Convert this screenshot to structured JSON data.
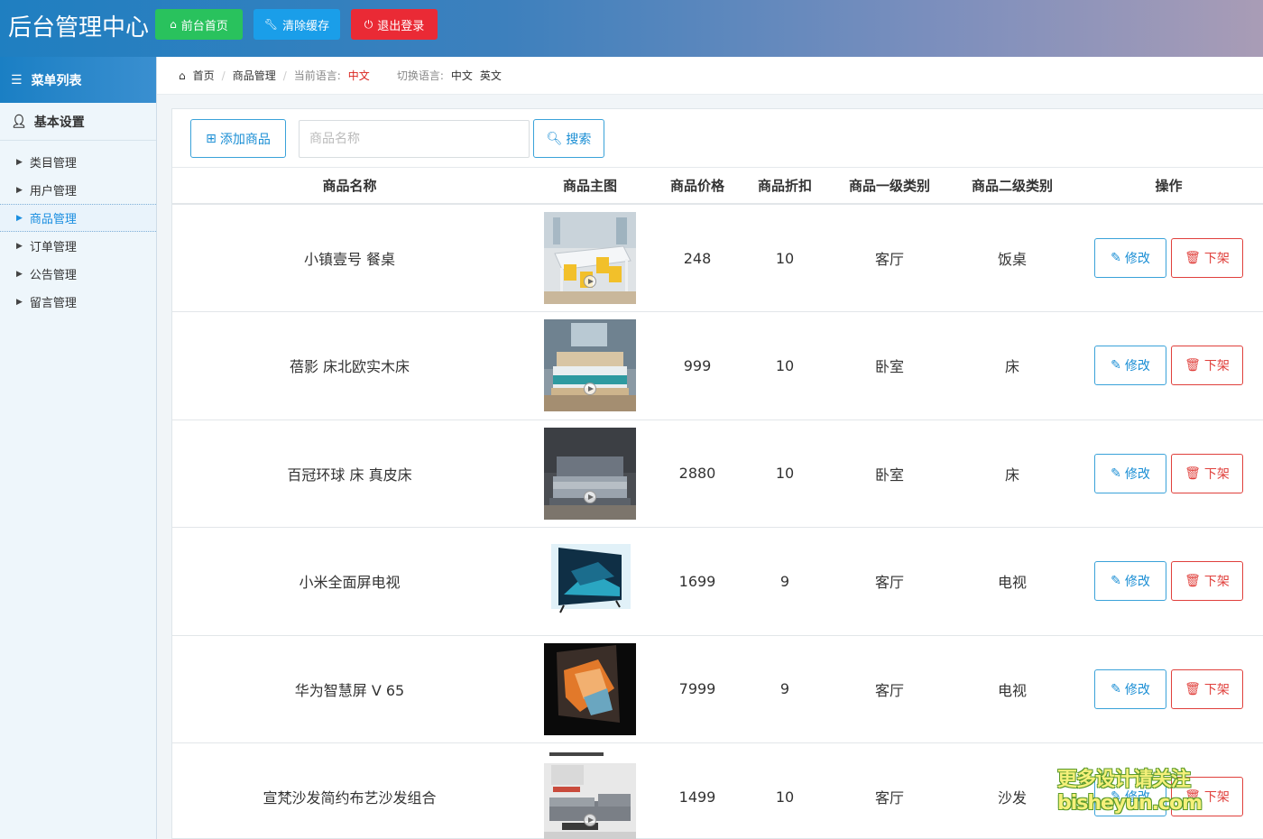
{
  "header": {
    "title": "后台管理中心",
    "buttons": {
      "home": "前台首页",
      "cache": "清除缓存",
      "logout": "退出登录"
    }
  },
  "sidebar": {
    "menu_title": "菜单列表",
    "section": "基本设置",
    "items": [
      {
        "label": "类目管理"
      },
      {
        "label": "用户管理"
      },
      {
        "label": "商品管理"
      },
      {
        "label": "订单管理"
      },
      {
        "label": "公告管理"
      },
      {
        "label": "留言管理"
      }
    ],
    "active_index": 2
  },
  "breadcrumb": {
    "home": "首页",
    "current": "商品管理",
    "lang_label": "当前语言:",
    "lang_value": "中文",
    "switch_label": "切换语言:",
    "lang_zh": "中文",
    "lang_en": "英文"
  },
  "toolbar": {
    "add_label": "添加商品",
    "search_placeholder": "商品名称",
    "search_label": "搜索"
  },
  "table": {
    "headers": [
      "商品名称",
      "商品主图",
      "商品价格",
      "商品折扣",
      "商品一级类别",
      "商品二级类别",
      "操作"
    ],
    "edit_label": "修改",
    "down_label": "下架",
    "rows": [
      {
        "name": "小镇壹号 餐桌",
        "price": "248",
        "discount": "10",
        "cat1": "客厅",
        "cat2": "饭桌",
        "image": "dining-table"
      },
      {
        "name": "蓓影 床北欧实木床",
        "price": "999",
        "discount": "10",
        "cat1": "卧室",
        "cat2": "床",
        "image": "wood-bed"
      },
      {
        "name": "百冠环球 床 真皮床",
        "price": "2880",
        "discount": "10",
        "cat1": "卧室",
        "cat2": "床",
        "image": "leather-bed"
      },
      {
        "name": "小米全面屏电视",
        "price": "1699",
        "discount": "9",
        "cat1": "客厅",
        "cat2": "电视",
        "image": "tv-blue"
      },
      {
        "name": "华为智慧屏 V 65",
        "price": "7999",
        "discount": "9",
        "cat1": "客厅",
        "cat2": "电视",
        "image": "tv-orange"
      },
      {
        "name": "宣梵沙发简约布艺沙发组合",
        "price": "1499",
        "discount": "10",
        "cat1": "客厅",
        "cat2": "沙发",
        "image": "sofa"
      }
    ]
  },
  "watermark": {
    "line1": "更多设计请关注",
    "line2": "bisheyun.com"
  },
  "colors": {
    "accent": "#1a8ed4",
    "danger": "#e0403c",
    "success": "#29c25d"
  }
}
